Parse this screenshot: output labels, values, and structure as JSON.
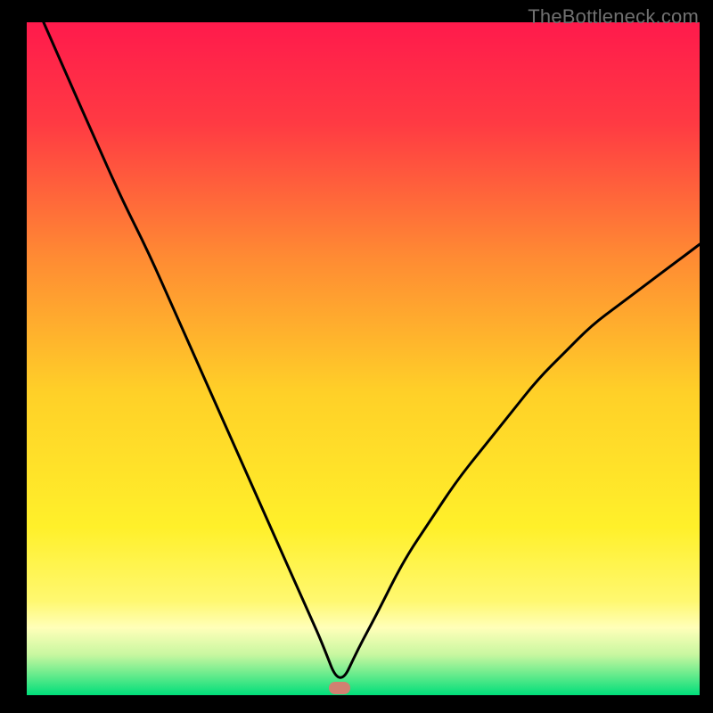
{
  "attribution": "TheBottleneck.com",
  "colors": {
    "top": "#ff1a4c",
    "mid": "#ffe12a",
    "pale": "#ffffb0",
    "green": "#00e07a",
    "marker": "#d18071",
    "stroke": "#000000"
  },
  "marker": {
    "x_pct": 46.5,
    "y_pct": 99.0
  },
  "chart_data": {
    "type": "line",
    "title": "",
    "xlabel": "",
    "ylabel": "",
    "xlim": [
      0,
      100
    ],
    "ylim": [
      0,
      100
    ],
    "note": "x and y are percentages of the plot area; y is read as 100−(pixel_y%). Values estimated from the image.",
    "series": [
      {
        "name": "left-branch",
        "x": [
          2.5,
          6,
          10,
          14,
          18,
          22,
          26,
          30,
          34,
          38,
          42,
          43.8,
          46.5
        ],
        "y": [
          100,
          92,
          83,
          74,
          66,
          57,
          48,
          39,
          30,
          21,
          12,
          8,
          1
        ]
      },
      {
        "name": "right-branch",
        "x": [
          46.5,
          49.3,
          52,
          56,
          60,
          64,
          68,
          72,
          76,
          80,
          84,
          88,
          92,
          96,
          100
        ],
        "y": [
          1,
          7,
          12,
          20,
          26,
          32,
          37,
          42,
          47,
          51,
          55,
          58,
          61,
          64,
          67
        ]
      }
    ]
  }
}
